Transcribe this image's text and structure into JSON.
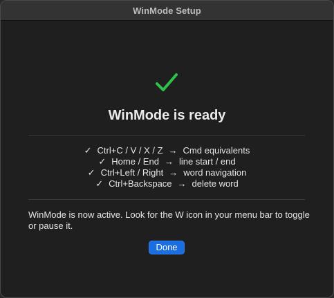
{
  "window": {
    "title": "WinMode Setup"
  },
  "status": {
    "icon": "checkmark-icon",
    "icon_color": "#2fc24a",
    "headline": "WinMode is ready"
  },
  "shortcuts": [
    {
      "tick": "✓",
      "keys": "Ctrl+C / V / X / Z",
      "arrow": "→",
      "action": "Cmd equivalents"
    },
    {
      "tick": "✓",
      "keys": "Home / End",
      "arrow": "→",
      "action": "line start / end"
    },
    {
      "tick": "✓",
      "keys": "Ctrl+Left / Right",
      "arrow": "→",
      "action": "word navigation"
    },
    {
      "tick": "✓",
      "keys": "Ctrl+Backspace",
      "arrow": "→",
      "action": "delete word"
    }
  ],
  "message": "WinMode is now active. Look for the W icon in your menu bar to toggle or pause it.",
  "buttons": {
    "done_label": "Done",
    "accent": "#1b6ee0"
  }
}
